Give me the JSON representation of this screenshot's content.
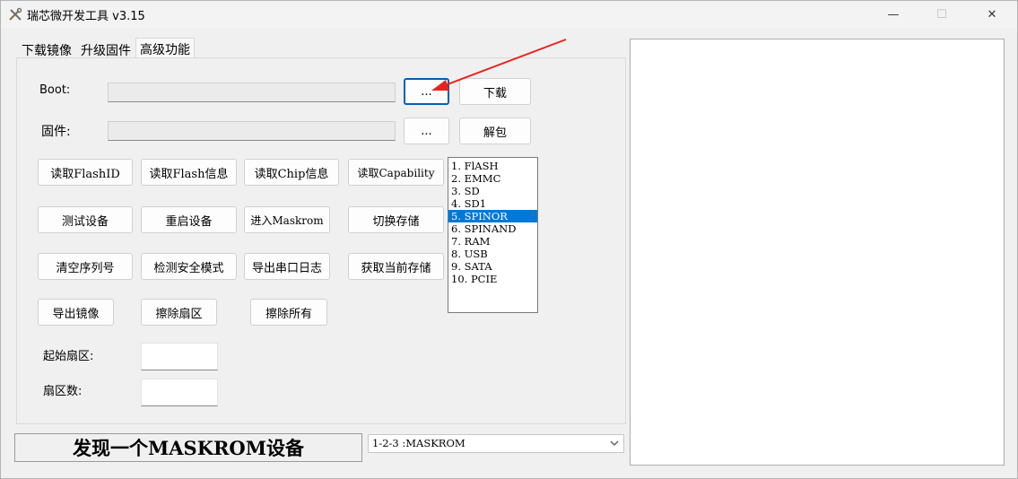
{
  "window": {
    "title": "瑞芯微开发工具 v3.15",
    "controls": {
      "minimize": "—",
      "maximize": "☐",
      "close": "✕"
    }
  },
  "tabs": [
    {
      "label": "下载镜像",
      "active": false
    },
    {
      "label": "升级固件",
      "active": false
    },
    {
      "label": "高级功能",
      "active": true
    }
  ],
  "advanced": {
    "boot_label": "Boot:",
    "boot_path": "",
    "boot_browse": "...",
    "download_button": "下载",
    "firmware_label": "固件:",
    "firmware_path": "",
    "firmware_browse": "...",
    "unpack_button": "解包",
    "buttons_row1": [
      "读取FlashID",
      "读取Flash信息",
      "读取Chip信息",
      "读取Capability"
    ],
    "buttons_row2": [
      "测试设备",
      "重启设备",
      "进入Maskrom",
      "切换存储"
    ],
    "buttons_row3": [
      "清空序列号",
      "检测安全模式",
      "导出串口日志",
      "获取当前存储"
    ],
    "buttons_row4": [
      "导出镜像",
      "擦除扇区",
      "擦除所有"
    ],
    "start_sector_label": "起始扇区:",
    "start_sector_value": "",
    "sector_count_label": "扇区数:",
    "sector_count_value": "",
    "storage_list": [
      "1. FlASH",
      "2. EMMC",
      "3. SD",
      "4. SD1",
      "5. SPINOR",
      "6. SPINAND",
      "7. RAM",
      "8. USB",
      "9. SATA",
      "10. PCIE"
    ],
    "storage_selected": "5. SPINOR"
  },
  "status": {
    "message": "发现一个MASKROM设备",
    "device_selected": "1-2-3 :MASKROM"
  },
  "log": {
    "text": ""
  },
  "colors": {
    "selection": "#0078d7",
    "focus_border": "#005fb8",
    "annotation_arrow": "#e8231e"
  }
}
